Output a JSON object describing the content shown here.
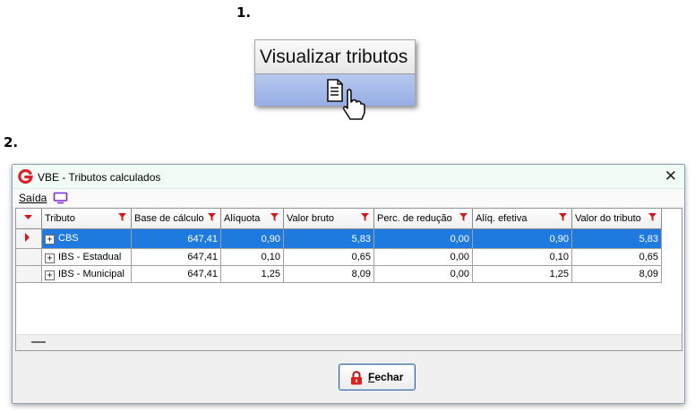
{
  "steps": {
    "one": "1.",
    "two": "2."
  },
  "zoom_button": {
    "label": "Visualizar tributos",
    "icon": "document-icon",
    "cursor": "hand-pointer-icon"
  },
  "window": {
    "title": "VBE - Tributos calculados",
    "logo": "G",
    "close_icon": "close-icon",
    "menu": {
      "saida_label": "Saída",
      "monitor_icon": "monitor-icon"
    },
    "grid": {
      "columns": [
        "Tributo",
        "Base de cálculo",
        "Alíquota",
        "Valor bruto",
        "Perc. de redução",
        "Alíq. efetiva",
        "Valor do tributo"
      ],
      "rows": [
        {
          "tributo": "CBS",
          "base": "647,41",
          "aliquota": "0,90",
          "valor_bruto": "5,83",
          "perc_reducao": "0,00",
          "aliq_efetiva": "0,90",
          "valor_tributo": "5,83",
          "selected": true
        },
        {
          "tributo": "IBS - Estadual",
          "base": "647,41",
          "aliquota": "0,10",
          "valor_bruto": "0,65",
          "perc_reducao": "0,00",
          "aliq_efetiva": "0,10",
          "valor_tributo": "0,65",
          "selected": false
        },
        {
          "tributo": "IBS - Municipal",
          "base": "647,41",
          "aliquota": "1,25",
          "valor_bruto": "8,09",
          "perc_reducao": "0,00",
          "aliq_efetiva": "1,25",
          "valor_tributo": "8,09",
          "selected": false
        }
      ]
    },
    "close_button": {
      "label": "Fechar",
      "icon": "lock-icon"
    }
  },
  "colors": {
    "selection": "#1e7adf",
    "filter_red": "#d01818",
    "accent_purple": "#7b2bd4"
  }
}
